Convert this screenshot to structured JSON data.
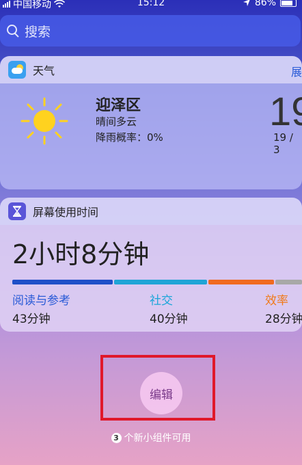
{
  "status_bar": {
    "carrier": "中国移动",
    "time": "15:12",
    "battery": "86%"
  },
  "search": {
    "placeholder": "搜索"
  },
  "weather_widget": {
    "title": "天气",
    "expand_label": "展",
    "location": "迎泽区",
    "condition": "晴间多云",
    "rain_chance": "降雨概率：0%",
    "temperature": "19",
    "range": "19 / 3"
  },
  "screen_time_widget": {
    "title": "屏幕使用时间",
    "total": "2小时8分钟",
    "categories": [
      {
        "name": "阅读与参考",
        "duration": "43分钟",
        "color": "#2a5bd7"
      },
      {
        "name": "社交",
        "duration": "40分钟",
        "color": "#1aa6d9"
      },
      {
        "name": "效率",
        "duration": "28分钟",
        "color": "#f07a1a"
      }
    ],
    "bar_colors": [
      "#1f4fc8",
      "#20a4d6",
      "#f06a20",
      "#a8a8a8"
    ]
  },
  "edit": {
    "label": "编辑"
  },
  "footer": {
    "count": "3",
    "text": "个新小组件可用"
  },
  "colors": {
    "highlight": "#e0182a"
  }
}
